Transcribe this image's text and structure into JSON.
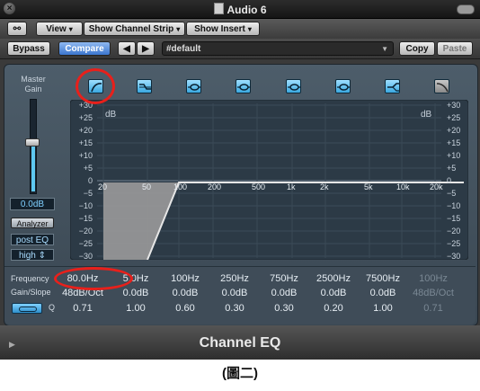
{
  "window": {
    "title": "Audio 6"
  },
  "toolbar": {
    "view": "View",
    "show_channel_strip": "Show Channel Strip",
    "show_insert": "Show Insert",
    "bypass": "Bypass",
    "compare": "Compare",
    "prev": "◀",
    "next": "▶",
    "preset": "#default",
    "copy": "Copy",
    "paste": "Paste"
  },
  "master_gain": {
    "label_line1": "Master",
    "label_line2": "Gain",
    "value": "0.0dB",
    "level_fraction": 0.5
  },
  "analyzer": {
    "button": "Analyzer",
    "mode": "post EQ",
    "resolution": "high"
  },
  "bands": [
    {
      "name": "low-cut",
      "active": true
    },
    {
      "name": "low-shelf",
      "active": true
    },
    {
      "name": "parametric-1",
      "active": true
    },
    {
      "name": "parametric-2",
      "active": true
    },
    {
      "name": "parametric-3",
      "active": true
    },
    {
      "name": "parametric-4",
      "active": true
    },
    {
      "name": "high-shelf",
      "active": true
    },
    {
      "name": "high-cut",
      "active": false
    }
  ],
  "graph": {
    "db_unit": "dB",
    "db_scale": [
      "+30",
      "+25",
      "+20",
      "+15",
      "+10",
      "+5",
      "0",
      "−5",
      "−10",
      "−15",
      "−20",
      "−25",
      "−30"
    ],
    "freq_labels": [
      "20",
      "50",
      "100",
      "200",
      "500",
      "1k",
      "2k",
      "5k",
      "10k",
      "20k"
    ]
  },
  "params": {
    "row_labels": {
      "frequency": "Frequency",
      "gain_slope": "Gain/Slope",
      "q": "Q"
    },
    "frequency": [
      "80.0Hz",
      "5.0Hz",
      "100Hz",
      "250Hz",
      "750Hz",
      "2500Hz",
      "7500Hz",
      "100Hz"
    ],
    "gain": [
      "48dB/Oct",
      "0.0dB",
      "0.0dB",
      "0.0dB",
      "0.0dB",
      "0.0dB",
      "0.0dB",
      "48dB/Oct"
    ],
    "q": [
      "0.71",
      "1.00",
      "0.60",
      "0.30",
      "0.30",
      "0.20",
      "1.00",
      "0.71"
    ],
    "active": [
      true,
      true,
      true,
      true,
      true,
      true,
      true,
      false
    ]
  },
  "plugin_name": "Channel EQ",
  "caption": "(圖二)",
  "colors": {
    "highlight_ring": "#e8201b",
    "band_on": "#3aa8e0",
    "curve_fill": "#9a9a9a"
  }
}
